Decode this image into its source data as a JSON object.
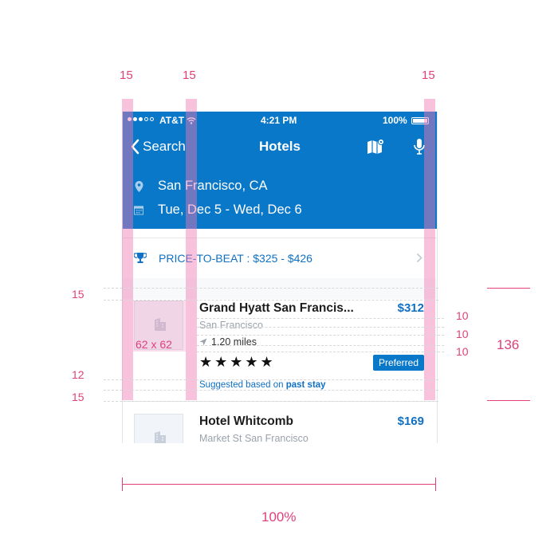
{
  "annotations": {
    "col_left": "15",
    "col_mid": "15",
    "col_right": "15",
    "row_top": "15",
    "row_mid": "12",
    "row_bottom": "15",
    "gap_1": "10",
    "gap_2": "10",
    "gap_3": "10",
    "card_height": "136",
    "thumb_size": "62 x 62",
    "width_label": "100%"
  },
  "status_bar": {
    "carrier": "AT&T",
    "time": "4:21 PM",
    "battery": "100%"
  },
  "nav": {
    "back_label": "Search",
    "title": "Hotels",
    "map_icon": "map-icon",
    "mic_icon": "microphone-icon"
  },
  "search": {
    "location": "San Francisco, CA",
    "dates": "Tue, Dec 5 - Wed,  Dec 6"
  },
  "promo": {
    "label": "PRICE-TO-BEAT : $325 - $426"
  },
  "hotels": [
    {
      "name": "Grand Hyatt San Francis...",
      "price": "$312",
      "location": "San Francisco",
      "distance": "1.20 miles",
      "stars": "★★★★★",
      "badge": "Preferred",
      "suggestion_prefix": "Suggested based on ",
      "suggestion_bold": "past stay"
    },
    {
      "name": "Hotel Whitcomb",
      "price": "$169",
      "location": "Market St San Francisco"
    }
  ],
  "colors": {
    "brand_blue": "#0a78c9",
    "link_blue": "#1070c4",
    "annotation_pink": "#e0407a"
  }
}
